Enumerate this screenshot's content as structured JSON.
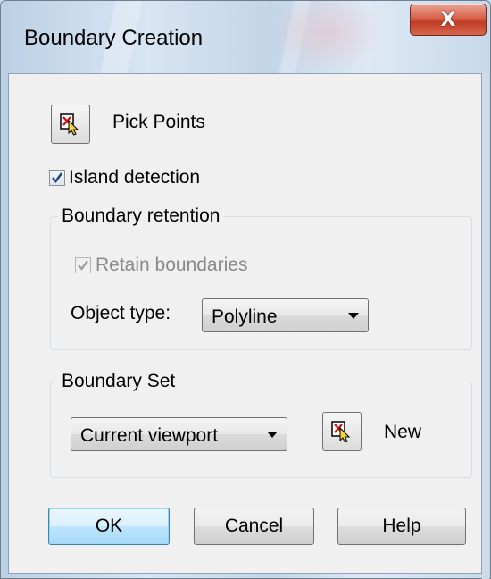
{
  "window": {
    "title": "Boundary Creation",
    "close_glyph": "X"
  },
  "pick_points": {
    "label": "Pick Points",
    "icon": "pick-points-icon"
  },
  "island_detection": {
    "label": "Island detection",
    "checked": true
  },
  "boundary_retention": {
    "legend": "Boundary retention",
    "retain_label": "Retain boundaries",
    "retain_checked": true,
    "retain_disabled": true,
    "object_type_label": "Object type:",
    "object_type_value": "Polyline"
  },
  "boundary_set": {
    "legend": "Boundary Set",
    "set_value": "Current viewport",
    "new_label": "New",
    "new_icon": "pick-points-icon"
  },
  "buttons": {
    "ok": "OK",
    "cancel": "Cancel",
    "help": "Help"
  },
  "colors": {
    "close_button": "#c8462d",
    "default_button_border": "#3c7fb1",
    "dialog_bg": "#f0f0f0"
  }
}
